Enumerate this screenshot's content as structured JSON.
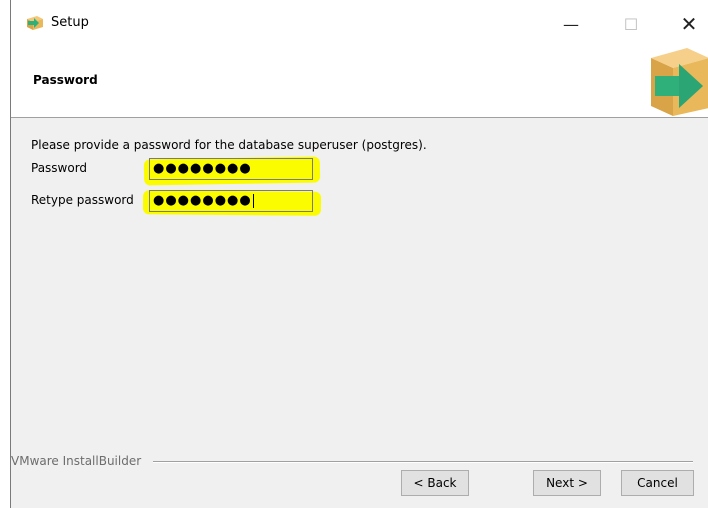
{
  "window": {
    "title": "Setup",
    "controls": {
      "minimize": "—",
      "maximize": "☐",
      "close": "✕"
    }
  },
  "header": {
    "title": "Password"
  },
  "content": {
    "description": "Please provide a password for the database superuser (postgres).",
    "fields": [
      {
        "label": "Password",
        "value": "●●●●●●●●"
      },
      {
        "label": "Retype password",
        "value": "●●●●●●●●"
      }
    ]
  },
  "footer": {
    "group_label": "VMware InstallBuilder",
    "buttons": {
      "back": "< Back",
      "next": "Next >",
      "cancel": "Cancel"
    }
  },
  "colors": {
    "highlight": "#fcfc00",
    "logo_box": "#e9b85b",
    "logo_arrow": "#2fb07a"
  },
  "icons": {
    "app": "installer-box-arrow-icon",
    "header_logo": "installer-box-arrow-icon"
  }
}
